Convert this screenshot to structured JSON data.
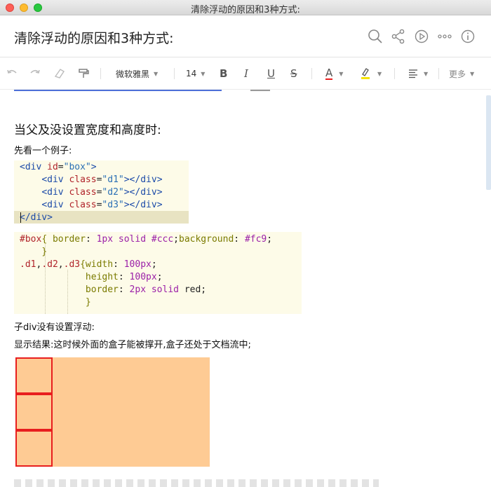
{
  "window": {
    "title": "清除浮动的原因和3种方式:"
  },
  "header": {
    "title": "清除浮动的原因和3种方式:",
    "icons": [
      "search-icon",
      "share-icon",
      "present-icon",
      "more-icon",
      "info-icon"
    ]
  },
  "toolbar": {
    "font_family": "微软雅黑",
    "font_size": "14",
    "bold": "B",
    "italic": "I",
    "underline": "U",
    "strikethrough": "S",
    "font_color_label": "A",
    "font_color": "#e81e1e",
    "highlight_color": "#f5e300",
    "more": "更多"
  },
  "content": {
    "heading": "当父及没设置宽度和高度时:",
    "intro": "先看一个例子:",
    "code_html": [
      {
        "indent": "",
        "parts": [
          [
            "tag",
            "<div "
          ],
          [
            "attr",
            "id"
          ],
          [
            "plain",
            "="
          ],
          [
            "str",
            "\"box\""
          ],
          [
            "tag",
            ">"
          ]
        ]
      },
      {
        "indent": "    ",
        "parts": [
          [
            "tag",
            "<div "
          ],
          [
            "attr",
            "class"
          ],
          [
            "plain",
            "="
          ],
          [
            "str",
            "\"d1\""
          ],
          [
            "tag",
            "></div>"
          ]
        ]
      },
      {
        "indent": "    ",
        "parts": [
          [
            "tag",
            "<div "
          ],
          [
            "attr",
            "class"
          ],
          [
            "plain",
            "="
          ],
          [
            "str",
            "\"d2\""
          ],
          [
            "tag",
            "></div>"
          ]
        ]
      },
      {
        "indent": "    ",
        "parts": [
          [
            "tag",
            "<div "
          ],
          [
            "attr",
            "class"
          ],
          [
            "plain",
            "="
          ],
          [
            "str",
            "\"d3\""
          ],
          [
            "tag",
            "></div>"
          ]
        ]
      },
      {
        "indent": "",
        "parts": [
          [
            "tag",
            "</div>"
          ]
        ]
      }
    ],
    "code_css": [
      {
        "indent": "",
        "parts": [
          [
            "sel",
            "#box"
          ],
          [
            "prop",
            "{ border"
          ],
          [
            "plain",
            ": "
          ],
          [
            "num",
            "1"
          ],
          [
            "propv",
            "px solid #ccc"
          ],
          [
            "plain",
            ";"
          ],
          [
            "prop",
            "background"
          ],
          [
            "plain",
            ": "
          ],
          [
            "propv",
            "#fc9"
          ],
          [
            "plain",
            ";"
          ]
        ]
      },
      {
        "indent": "    ",
        "parts": [
          [
            "prop",
            "}"
          ]
        ]
      },
      {
        "indent": "",
        "parts": [
          [
            "sel",
            ".d1"
          ],
          [
            "plain",
            ","
          ],
          [
            "sel",
            ".d2"
          ],
          [
            "plain",
            ","
          ],
          [
            "sel",
            ".d3"
          ],
          [
            "prop",
            "{width"
          ],
          [
            "plain",
            ": "
          ],
          [
            "num",
            "100"
          ],
          [
            "propv",
            "px"
          ],
          [
            "plain",
            ";"
          ]
        ]
      },
      {
        "indent": "            ",
        "parts": [
          [
            "prop",
            "height"
          ],
          [
            "plain",
            ": "
          ],
          [
            "num",
            "100"
          ],
          [
            "propv",
            "px"
          ],
          [
            "plain",
            ";"
          ]
        ]
      },
      {
        "indent": "            ",
        "parts": [
          [
            "prop",
            "border"
          ],
          [
            "plain",
            ": "
          ],
          [
            "num",
            "2"
          ],
          [
            "propv",
            "px solid "
          ],
          [
            "plain",
            "red;"
          ]
        ]
      },
      {
        "indent": "            ",
        "parts": [
          [
            "prop",
            "}"
          ]
        ]
      }
    ],
    "note1": "子div没有设置浮动:",
    "note2": "显示结果:这时候外面的盒子能被撑开,盒子还处于文档流中;",
    "demo_colors": {
      "background": "#fecb94",
      "border": "#e81e1e"
    }
  }
}
